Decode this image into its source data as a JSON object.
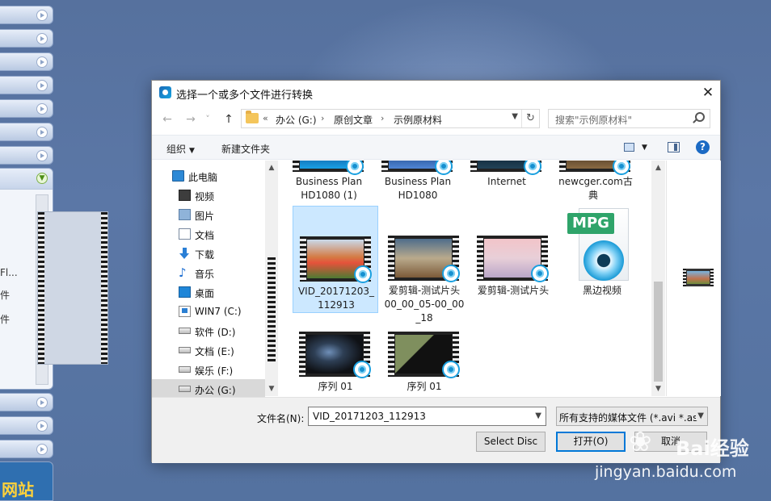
{
  "background": {
    "side_panel_lines": [
      "Fl...",
      "件",
      "件"
    ],
    "promo_text": "网站"
  },
  "dialog": {
    "title": "选择一个或多个文件进行转换",
    "close": "✕",
    "nav": {
      "back": "←",
      "forward": "→",
      "recent": "˅",
      "up": "↑"
    },
    "address": {
      "overflow": "«",
      "crumbs": [
        "办公 (G:)",
        "原创文章",
        "示例原材料"
      ],
      "separator": "›",
      "refresh": "↻"
    },
    "search_placeholder": "搜索\"示例原材料\"",
    "toolbar": {
      "organize": "组织",
      "new_folder": "新建文件夹",
      "help": "?"
    },
    "nav_items": [
      {
        "label": "此电脑",
        "icon": "computer-icon"
      },
      {
        "label": "视频",
        "icon": "video-folder-icon"
      },
      {
        "label": "图片",
        "icon": "picture-folder-icon"
      },
      {
        "label": "文档",
        "icon": "document-folder-icon"
      },
      {
        "label": "下载",
        "icon": "download-icon"
      },
      {
        "label": "音乐",
        "icon": "music-icon"
      },
      {
        "label": "桌面",
        "icon": "desktop-icon"
      },
      {
        "label": "WIN7 (C:)",
        "icon": "system-drive-icon"
      },
      {
        "label": "软件 (D:)",
        "icon": "drive-icon"
      },
      {
        "label": "文档 (E:)",
        "icon": "drive-icon"
      },
      {
        "label": "娱乐 (F:)",
        "icon": "drive-icon"
      },
      {
        "label": "办公 (G:)",
        "icon": "drive-icon",
        "selected": true
      }
    ],
    "files_row1": [
      {
        "name1": "Business Plan",
        "name2": "HD1080 (1)"
      },
      {
        "name1": "Business Plan",
        "name2": "HD1080"
      },
      {
        "name1": "Internet",
        "name2": ""
      },
      {
        "name1": "newcger.com古",
        "name2": "典 "
      }
    ],
    "files_row2": [
      {
        "name1": "VID_20171203_",
        "name2": "112913",
        "name3": "",
        "selected": true
      },
      {
        "name1": "爱剪辑-测试片头",
        "name2": "00_00_05-00_00",
        "name3": "_18"
      },
      {
        "name1": "爱剪辑-测试片头",
        "name2": "",
        "name3": ""
      },
      {
        "name1": "黑边视频",
        "name2": "",
        "name3": "",
        "type_label": "MPG"
      }
    ],
    "files_row3": [
      {
        "name1": "序列 01"
      },
      {
        "name1": "序列 01"
      }
    ],
    "filename_label": "文件名(N):",
    "filename_value": "VID_20171203_112913",
    "filetype_value": "所有支持的媒体文件 (*.avi *.as",
    "select_disc": "Select Disc",
    "open": "打开(O)",
    "cancel": "取消"
  },
  "watermark": {
    "brand": "Bai经验",
    "url": "jingyan.baidu.com"
  },
  "colors": {
    "selection": "#cce8ff",
    "accent": "#0078d7",
    "desktop": "#5a75a3"
  }
}
